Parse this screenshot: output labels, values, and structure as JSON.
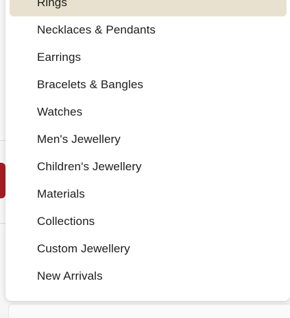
{
  "menu": {
    "highlight_color": "#e8e1cf",
    "items": [
      {
        "label": "Rings",
        "highlighted": true
      },
      {
        "label": "Necklaces & Pendants",
        "highlighted": false
      },
      {
        "label": "Earrings",
        "highlighted": false
      },
      {
        "label": "Bracelets & Bangles",
        "highlighted": false
      },
      {
        "label": "Watches",
        "highlighted": false
      },
      {
        "label": "Men's Jewellery",
        "highlighted": false
      },
      {
        "label": "Children's Jewellery",
        "highlighted": false
      },
      {
        "label": "Materials",
        "highlighted": false
      },
      {
        "label": "Collections",
        "highlighted": false
      },
      {
        "label": "Custom Jewellery",
        "highlighted": false
      },
      {
        "label": "New Arrivals",
        "highlighted": false
      }
    ]
  }
}
